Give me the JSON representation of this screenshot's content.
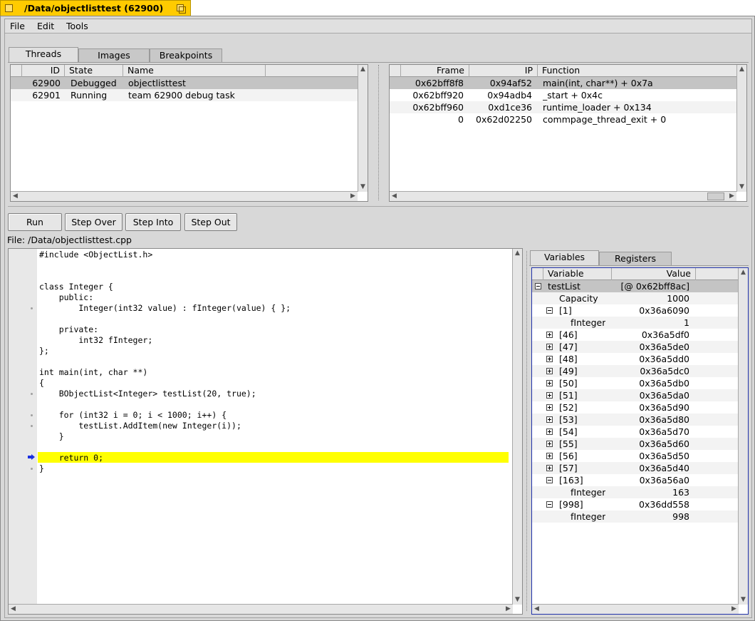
{
  "window": {
    "title": "/Data/objectlisttest (62900)"
  },
  "menu": [
    "File",
    "Edit",
    "Tools"
  ],
  "top_tabs": [
    "Threads",
    "Images",
    "Breakpoints"
  ],
  "threads": {
    "columns": [
      "ID",
      "State",
      "Name"
    ],
    "rows": [
      {
        "id": "62900",
        "state": "Debugged",
        "name": "objectlisttest"
      },
      {
        "id": "62901",
        "state": "Running",
        "name": "team 62900 debug task"
      }
    ]
  },
  "stack": {
    "columns": [
      "Frame",
      "IP",
      "Function"
    ],
    "rows": [
      {
        "frame": "0x62bff8f8",
        "ip": "0x94af52",
        "function": "main(int, char**) + 0x7a"
      },
      {
        "frame": "0x62bff920",
        "ip": "0x94adb4",
        "function": "_start + 0x4c"
      },
      {
        "frame": "0x62bff960",
        "ip": "0xd1ce36",
        "function": "runtime_loader + 0x134"
      },
      {
        "frame": "0",
        "ip": "0x62d02250",
        "function": "commpage_thread_exit + 0"
      }
    ]
  },
  "buttons": {
    "run": "Run",
    "step_over": "Step Over",
    "step_into": "Step Into",
    "step_out": "Step Out"
  },
  "file_label": "File: /Data/objectlisttest.cpp",
  "source_lines": [
    "#include <ObjectList.h>",
    "",
    "",
    "class Integer {",
    "    public:",
    "        Integer(int32 value) : fInteger(value) { };",
    "",
    "    private:",
    "        int32 fInteger;",
    "};",
    "",
    "int main(int, char **)",
    "{",
    "    BObjectList<Integer> testList(20, true);",
    "",
    "    for (int32 i = 0; i < 1000; i++) {",
    "        testList.AddItem(new Integer(i));",
    "    }",
    "",
    "    return 0;",
    "}"
  ],
  "bottom_tabs": [
    "Variables",
    "Registers"
  ],
  "variables": {
    "columns": [
      "Variable",
      "Value"
    ],
    "rows": [
      {
        "name": "testList",
        "value": "[@ 0x62bff8ac]",
        "level": 0,
        "expander": "minus"
      },
      {
        "name": "Capacity",
        "value": "1000",
        "level": 1,
        "expander": "none"
      },
      {
        "name": "[1]",
        "value": "0x36a6090",
        "level": 1,
        "expander": "minus"
      },
      {
        "name": "fInteger",
        "value": "1",
        "level": 2,
        "expander": "none"
      },
      {
        "name": "[46]",
        "value": "0x36a5df0",
        "level": 1,
        "expander": "plus"
      },
      {
        "name": "[47]",
        "value": "0x36a5de0",
        "level": 1,
        "expander": "plus"
      },
      {
        "name": "[48]",
        "value": "0x36a5dd0",
        "level": 1,
        "expander": "plus"
      },
      {
        "name": "[49]",
        "value": "0x36a5dc0",
        "level": 1,
        "expander": "plus"
      },
      {
        "name": "[50]",
        "value": "0x36a5db0",
        "level": 1,
        "expander": "plus"
      },
      {
        "name": "[51]",
        "value": "0x36a5da0",
        "level": 1,
        "expander": "plus"
      },
      {
        "name": "[52]",
        "value": "0x36a5d90",
        "level": 1,
        "expander": "plus"
      },
      {
        "name": "[53]",
        "value": "0x36a5d80",
        "level": 1,
        "expander": "plus"
      },
      {
        "name": "[54]",
        "value": "0x36a5d70",
        "level": 1,
        "expander": "plus"
      },
      {
        "name": "[55]",
        "value": "0x36a5d60",
        "level": 1,
        "expander": "plus"
      },
      {
        "name": "[56]",
        "value": "0x36a5d50",
        "level": 1,
        "expander": "plus"
      },
      {
        "name": "[57]",
        "value": "0x36a5d40",
        "level": 1,
        "expander": "plus"
      },
      {
        "name": "[163]",
        "value": "0x36a56a0",
        "level": 1,
        "expander": "minus"
      },
      {
        "name": "fInteger",
        "value": "163",
        "level": 2,
        "expander": "none"
      },
      {
        "name": "[998]",
        "value": "0x36dd558",
        "level": 1,
        "expander": "minus"
      },
      {
        "name": "fInteger",
        "value": "998",
        "level": 2,
        "expander": "none"
      }
    ]
  },
  "colors": {
    "tab_yellow": "#ffcb00",
    "current_line": "#ffff00",
    "pc_arrow": "#1a2fe0",
    "selection": "#c4c4c4"
  },
  "icons": {
    "close": "close-box-icon",
    "zoom": "zoom-box-icon",
    "pc": "current-line-arrow-icon"
  }
}
